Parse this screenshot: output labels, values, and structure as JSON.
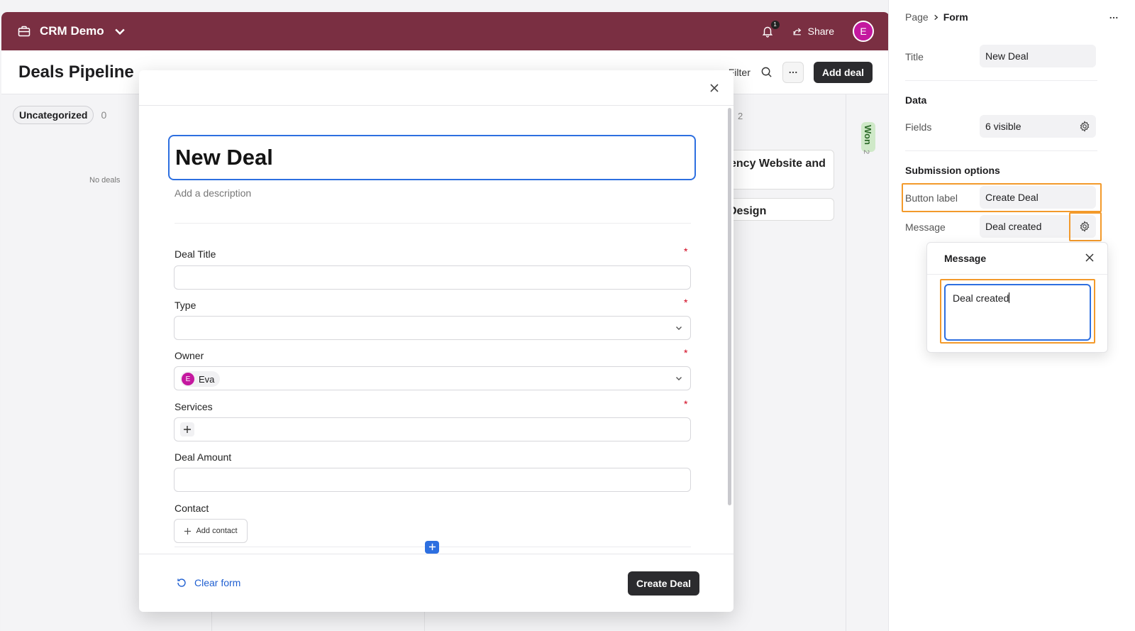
{
  "app": {
    "name": "CRM Demo",
    "notifications_count": "1",
    "share_label": "Share",
    "user_initial": "E"
  },
  "page": {
    "title": "Deals Pipeline",
    "filter_label": "Filter",
    "add_deal_label": "Add deal"
  },
  "board": {
    "uncategorized_label": "Uncategorized",
    "uncategorized_count": "0",
    "no_deals_text": "No deals",
    "card1_partial": "ency Website and",
    "card2_partial": "Design",
    "col3_count": "2",
    "won_label": "Won",
    "won_count": "2"
  },
  "form": {
    "title": "New Deal",
    "description_placeholder": "Add a description",
    "fields": [
      {
        "label": "Deal Title",
        "required": true
      },
      {
        "label": "Type",
        "required": true
      },
      {
        "label": "Owner",
        "required": true,
        "value": "Eva",
        "value_initial": "E"
      },
      {
        "label": "Services",
        "required": true
      },
      {
        "label": "Deal Amount",
        "required": false
      },
      {
        "label": "Contact",
        "required": false
      }
    ],
    "required_marker": "*",
    "add_contact_label": "Add contact",
    "clear_form_label": "Clear form",
    "submit_label": "Create Deal"
  },
  "panel": {
    "breadcrumb_parent": "Page",
    "breadcrumb_current": "Form",
    "title_label": "Title",
    "title_value": "New Deal",
    "data_section": "Data",
    "fields_label": "Fields",
    "fields_value": "6 visible",
    "submission_section": "Submission options",
    "button_label_label": "Button label",
    "button_label_value": "Create Deal",
    "message_label": "Message",
    "message_value": "Deal created"
  },
  "popover": {
    "title": "Message",
    "text": "Deal created"
  },
  "colors": {
    "topbar": "#7a2f42",
    "accent_blue": "#2d6fe0",
    "highlight_orange": "#f39a2b",
    "avatar_magenta": "#c4189f",
    "dark_button": "#2b2b2e"
  },
  "icons": [
    "briefcase-icon",
    "chevron-down-icon",
    "bell-icon",
    "share-icon",
    "search-icon",
    "more-icon",
    "close-icon",
    "plus-icon",
    "refresh-icon",
    "gear-icon",
    "chevron-right-icon"
  ]
}
